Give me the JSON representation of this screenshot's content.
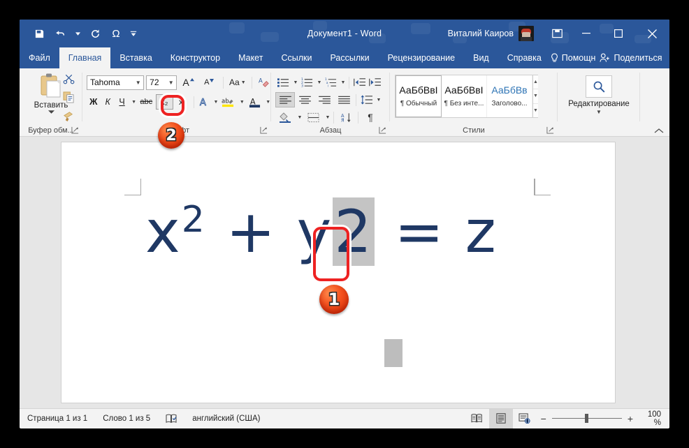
{
  "window": {
    "title": "Документ1  -  Word",
    "account_name": "Виталий Каиров",
    "minimize": "—",
    "maximize": "□",
    "close": "✕"
  },
  "quick_access": {
    "save": "save-icon",
    "undo": "undo-icon",
    "redo": "redo-icon",
    "symbol": "Ω",
    "customize": "customize-icon"
  },
  "tabs": [
    {
      "label": "Файл",
      "active": false
    },
    {
      "label": "Главная",
      "active": true
    },
    {
      "label": "Вставка",
      "active": false
    },
    {
      "label": "Конструктор",
      "active": false
    },
    {
      "label": "Макет",
      "active": false
    },
    {
      "label": "Ссылки",
      "active": false
    },
    {
      "label": "Рассылки",
      "active": false
    },
    {
      "label": "Рецензирование",
      "active": false
    },
    {
      "label": "Вид",
      "active": false
    },
    {
      "label": "Справка",
      "active": false
    }
  ],
  "tab_right": {
    "tellme": "Помощн",
    "share": "Поделиться"
  },
  "ribbon": {
    "clipboard": {
      "group_label": "Буфер обм...",
      "paste_label": "Вставить",
      "cut": "scissors-icon",
      "copy": "copy-icon",
      "format_painter": "format-painter-icon"
    },
    "font": {
      "group_label": "Шрифт",
      "font_name": "Tahoma",
      "font_size": "72",
      "grow_font": "A",
      "shrink_font": "A",
      "change_case": "Aa",
      "clear_formatting": "clear-formatting-icon",
      "bold": "Ж",
      "italic": "К",
      "underline": "Ч",
      "strikethrough": "abc",
      "subscript": "x₂",
      "superscript": "x²",
      "text_effects": "A",
      "highlight": "ab",
      "font_color": "A"
    },
    "paragraph": {
      "group_label": "Абзац",
      "bullets": "bullets-icon",
      "numbering": "numbering-icon",
      "multilevel": "multilevel-list-icon",
      "decrease_indent": "decrease-indent-icon",
      "increase_indent": "increase-indent-icon",
      "align_left": "align-left-icon",
      "align_center": "align-center-icon",
      "align_right": "align-right-icon",
      "justify": "justify-icon",
      "line_spacing": "line-spacing-icon",
      "shading": "shading-icon",
      "borders": "borders-icon",
      "sort": "sort-icon",
      "show_marks": "¶"
    },
    "styles": {
      "group_label": "Стили",
      "items": [
        {
          "preview": "АаБбВвI",
          "name": "¶ Обычный",
          "selected": true,
          "blue": false
        },
        {
          "preview": "АаБбВвI",
          "name": "¶ Без инте...",
          "selected": false,
          "blue": false
        },
        {
          "preview": "АаБбВв",
          "name": "Заголово...",
          "selected": false,
          "blue": true
        }
      ]
    },
    "editing": {
      "label": "Редактирование",
      "icon": "search-icon"
    },
    "collapse": "collapse-ribbon-icon"
  },
  "document": {
    "equation_parts": [
      {
        "text": "x",
        "type": "base"
      },
      {
        "text": "2",
        "type": "superscript"
      },
      {
        "text": " + ",
        "type": "base"
      },
      {
        "text": "y",
        "type": "base"
      },
      {
        "text": "2",
        "type": "selected"
      },
      {
        "text": " = ",
        "type": "base"
      },
      {
        "text": "z",
        "type": "base"
      }
    ],
    "equation_plain": "x2 + y2 = z",
    "text_color": "#1f3864",
    "selection_color": "#c4c4c4"
  },
  "annotations": [
    {
      "number": "1",
      "target": "selected-character-2"
    },
    {
      "number": "2",
      "target": "subscript-button"
    }
  ],
  "statusbar": {
    "page": "Страница 1 из 1",
    "words": "Слово 1 из 5",
    "proofing": "proofing-icon",
    "language": "английский (США)",
    "view_read": "read-mode-icon",
    "view_print": "print-layout-icon",
    "view_web": "web-layout-icon",
    "zoom_out": "−",
    "zoom_in": "+",
    "zoom_value": "100 %"
  }
}
